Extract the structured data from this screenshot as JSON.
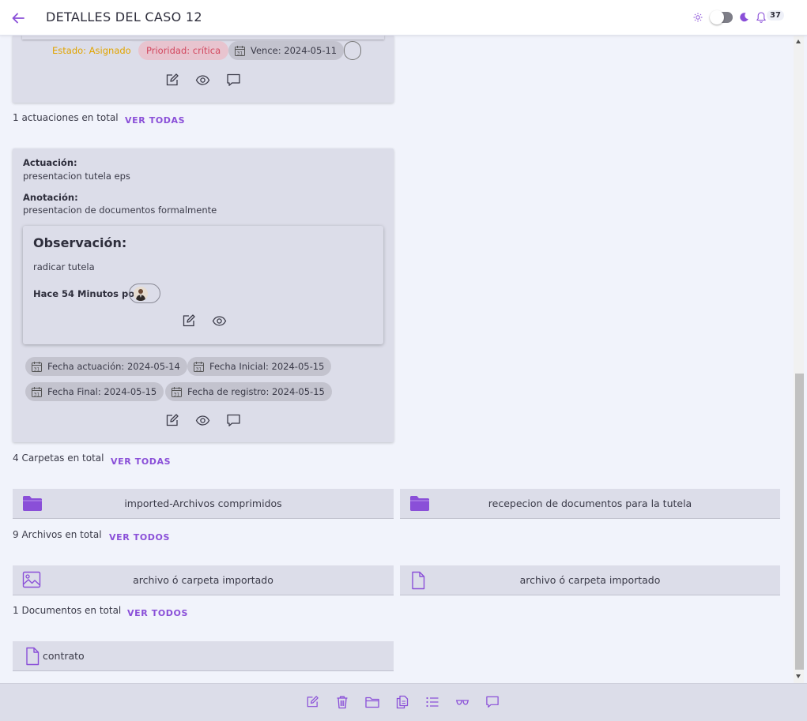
{
  "header": {
    "title": "DETALLES DEL CASO 12",
    "notification_count": "37"
  },
  "card_top": {
    "estado": "Estado: Asignado",
    "prioridad": "Prioridad: crítica",
    "vence": "Vence: 2024-05-11"
  },
  "actuaciones": {
    "total_text": "1 actuaciones en total",
    "ver_label": "VER TODAS"
  },
  "actuacion": {
    "actuacion_label": "Actuación:",
    "actuacion_value": "presentacion tutela eps",
    "anotacion_label": "Anotación:",
    "anotacion_value": "presentacion de documentos formalmente",
    "observacion": {
      "title": "Observación:",
      "text": "radicar tutela",
      "meta": "Hace 54 Minutos por"
    },
    "dates": {
      "fecha_actuacion": "Fecha actuación: 2024-05-14",
      "fecha_inicial": "Fecha Inicial: 2024-05-15",
      "fecha_final": "Fecha Final: 2024-05-15",
      "fecha_registro": "Fecha de registro: 2024-05-15"
    }
  },
  "carpetas": {
    "total_text": "4 Carpetas en total",
    "ver_label": "VER TODAS",
    "items": [
      "imported-Archivos comprimidos",
      "recepecion de documentos para la tutela"
    ]
  },
  "archivos": {
    "total_text": "9 Archivos en total",
    "ver_label": "VER TODOS",
    "items": [
      "archivo ó carpeta importado",
      "archivo ó carpeta importado"
    ]
  },
  "documentos": {
    "total_text": "1 Documentos en total",
    "ver_label": "VER TODOS",
    "items": [
      "contrato"
    ]
  },
  "colors": {
    "accent": "#8a4fd8",
    "card_bg": "#dcdde9",
    "page_bg": "#f1f3fb",
    "estado": "#e1a400",
    "prioridad": "#d2485f"
  }
}
